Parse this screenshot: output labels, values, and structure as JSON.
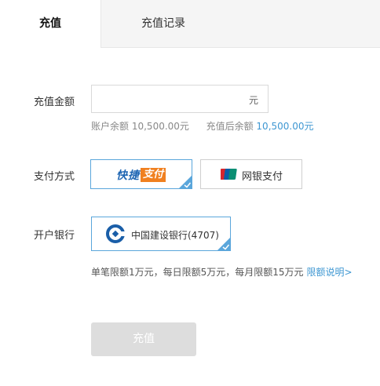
{
  "tabs": {
    "recharge": "充值",
    "history": "充值记录"
  },
  "form": {
    "amount_label": "充值金额",
    "amount_value": "",
    "amount_placeholder": "",
    "amount_unit": "元",
    "balance_label": "账户余额",
    "balance_value": "10,500.00元",
    "after_label": "充值后余额",
    "after_value": "10,500.00元",
    "payment_label": "支付方式",
    "payment_options": [
      {
        "label": "快捷支付",
        "logo_part1": "快捷",
        "logo_part2": "支付",
        "selected": true,
        "icon": "quick-pay-logo"
      },
      {
        "label": "网银支付",
        "selected": false,
        "icon": "unionpay-icon"
      }
    ],
    "bank_label": "开户银行",
    "bank_card": {
      "name": "中国建设银行(4707)",
      "icon": "ccb-logo-icon",
      "selected": true
    },
    "limit_text": "单笔限额1万元，每日限额5万元，每月限额15万元",
    "limit_link": "限额说明>",
    "submit_label": "充值"
  },
  "colors": {
    "accent": "#3e97d2",
    "selected_border": "#5aa6db",
    "quick_blue": "#1f66b3",
    "quick_orange": "#f08020",
    "button_disabled": "#dddddd",
    "ccb_blue": "#1a5ea8"
  }
}
